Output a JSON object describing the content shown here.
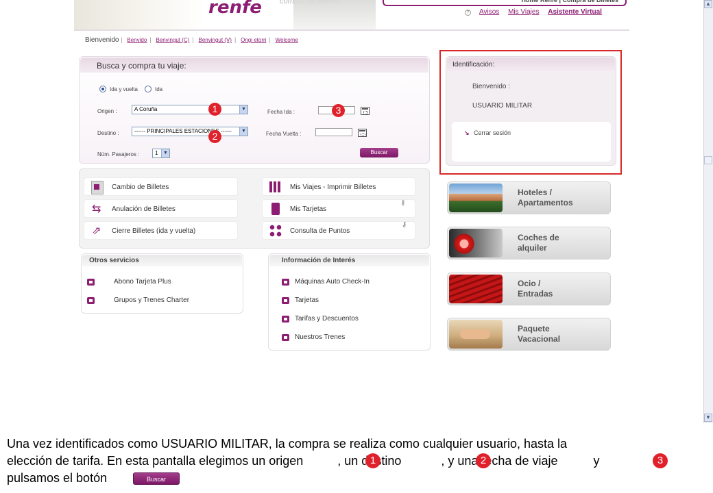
{
  "header": {
    "logo": "renfe",
    "logo_sub": "compra de billetes",
    "topmenu": "Home Renfe  |  Compra de Billetes",
    "links": {
      "avisos": "Avisos",
      "mis_viajes": "Mis Viajes",
      "asistente": "Asistente Virtual"
    }
  },
  "langbar": {
    "current": "Bienvenido",
    "items": [
      "Benvido",
      "Benvingut (C)",
      "Benvingut (V)",
      "Ongi etorri",
      "Welcome"
    ],
    "sep": "|"
  },
  "search": {
    "title": "Busca y compra tu viaje:",
    "radio_roundtrip": "Ida y vuelta",
    "radio_oneway": "Ida",
    "origin_label": "Origen :",
    "origin_value": "A Coruña",
    "dest_label": "Destino :",
    "dest_value": "------ PRINCIPALES ESTACIONES ------",
    "date_out_label": "Fecha Ida :",
    "date_back_label": "Fecha Vuelta :",
    "passengers_label": "Núm. Pasajeros :",
    "passengers_value": "1",
    "button": "Buscar",
    "markers": [
      "1",
      "2",
      "3"
    ]
  },
  "ident": {
    "title": "Identificación:",
    "welcome": "Bienvenido :",
    "user": "USUARIO MILITAR",
    "logout": "Cerrar sesión"
  },
  "quicklinks": {
    "left": [
      "Cambio de Billetes",
      "Anulación de Billetes",
      "Cierre Billetes (ida y vuelta)"
    ],
    "right": [
      "Mis Viajes - Imprimir Billetes",
      "Mis Tarjetas",
      "Consulta de Puntos"
    ]
  },
  "otros": {
    "title": "Otros servicios",
    "items": [
      "Abono Tarjeta Plus",
      "Grupos y Trenes Charter"
    ]
  },
  "info": {
    "title": "Información de Interés",
    "items": [
      "Máquinas Auto Check-In",
      "Tarjetas",
      "Tarifas y Descuentos",
      "Nuestros Trenes"
    ]
  },
  "promos": [
    {
      "l1": "Hoteles /",
      "l2": "Apartamentos"
    },
    {
      "l1": "Coches de",
      "l2": "alquiler"
    },
    {
      "l1": "Ocio /",
      "l2": "Entradas"
    },
    {
      "l1": "Paquete",
      "l2": "Vacacional"
    }
  ],
  "caption": {
    "line1": "Una vez identificados como USUARIO MILITAR, la compra se realiza como cualquier usuario, hasta la",
    "line2a": "elección de tarifa. En esta pantalla elegimos un origen",
    "line2b": ", un destino",
    "line2c": ", y una fecha de viaje",
    "line2d": "y",
    "line3": "pulsamos el botón",
    "button": "Buscar",
    "markers": [
      "1",
      "2",
      "3"
    ]
  },
  "colors": {
    "brand": "#8c1d72",
    "marker": "#e0202b",
    "highlight_border": "#d62828"
  }
}
